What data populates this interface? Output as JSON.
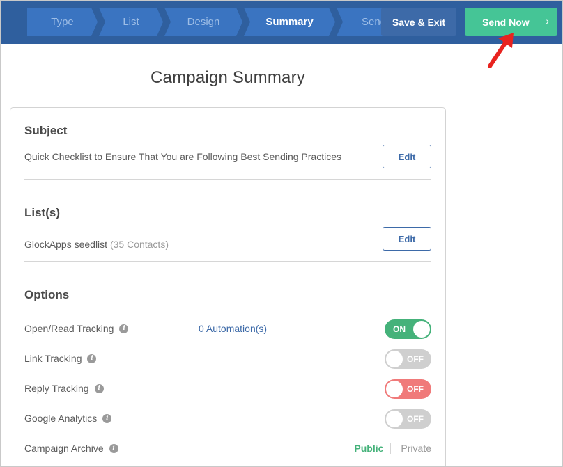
{
  "wizard": {
    "steps": [
      {
        "label": "Type"
      },
      {
        "label": "List"
      },
      {
        "label": "Design"
      },
      {
        "label": "Summary"
      },
      {
        "label": "Send"
      }
    ],
    "active_step": "Summary",
    "save_exit_label": "Save & Exit",
    "send_now_label": "Send Now",
    "send_now_chevron": "›"
  },
  "page": {
    "title": "Campaign Summary"
  },
  "subject": {
    "heading": "Subject",
    "value": "Quick Checklist to Ensure That You are Following Best Sending Practices",
    "edit_label": "Edit"
  },
  "lists": {
    "heading": "List(s)",
    "name": "GlockApps seedlist",
    "count": "(35 Contacts)",
    "edit_label": "Edit"
  },
  "options": {
    "heading": "Options",
    "rows": [
      {
        "label": "Open/Read Tracking",
        "extra": "0 Automation(s)",
        "toggle": "ON"
      },
      {
        "label": "Link Tracking",
        "toggle": "OFF"
      },
      {
        "label": "Reply Tracking",
        "toggle": "OFF"
      },
      {
        "label": "Google Analytics",
        "toggle": "OFF"
      }
    ],
    "archive": {
      "label": "Campaign Archive",
      "public_label": "Public",
      "private_label": "Private"
    }
  },
  "colors": {
    "topbar": "#2f5f9e",
    "step": "#3a74c1",
    "send_now": "#45c596",
    "toggle_on": "#45b27a",
    "toggle_red": "#f07a7a",
    "annotation_arrow": "#e8231f"
  },
  "icons": {
    "info": "info-icon",
    "annotation": "red-arrow-icon",
    "chevron": "chevron-right-icon"
  }
}
